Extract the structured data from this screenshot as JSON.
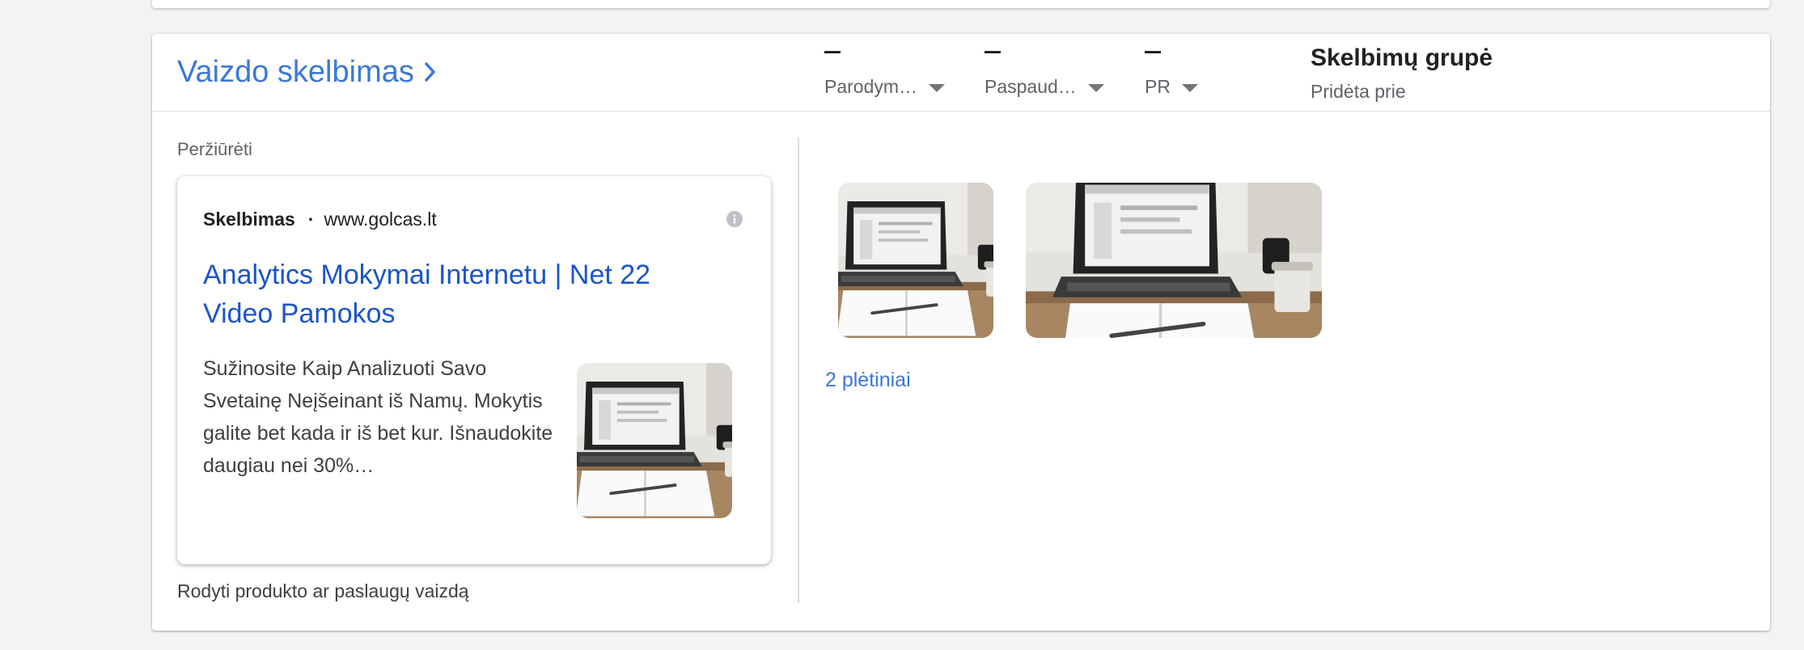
{
  "card": {
    "title": "Vaizdo skelbimas",
    "metrics": [
      {
        "value": "–",
        "label": "Parodym…"
      },
      {
        "value": "–",
        "label": "Paspaud…"
      },
      {
        "value": "–",
        "label": "PR"
      }
    ],
    "ad_group": {
      "title": "Skelbimų grupė",
      "subtitle": "Pridėta prie"
    },
    "preview_label": "Peržiūrėti",
    "ad": {
      "sponsored": "Skelbimas",
      "separator": "·",
      "url": "www.golcas.lt",
      "headline": "Analytics Mokymai Internetu | Net 22 Video Pamokos",
      "description": "Sužinosite Kaip Analizuoti Savo Svetainę Neįšeinant iš Namų. Mokytis galite bet kada ir iš bet kur. Išnaudokite daugiau nei 30%…"
    },
    "show_product_text": "Rodyti produkto ar paslaugų vaizdą",
    "extensions_link": "2 plėtiniai"
  },
  "colors": {
    "link": "#3c78d8",
    "headline": "#1a55c9",
    "background": "#f1f3f4"
  }
}
